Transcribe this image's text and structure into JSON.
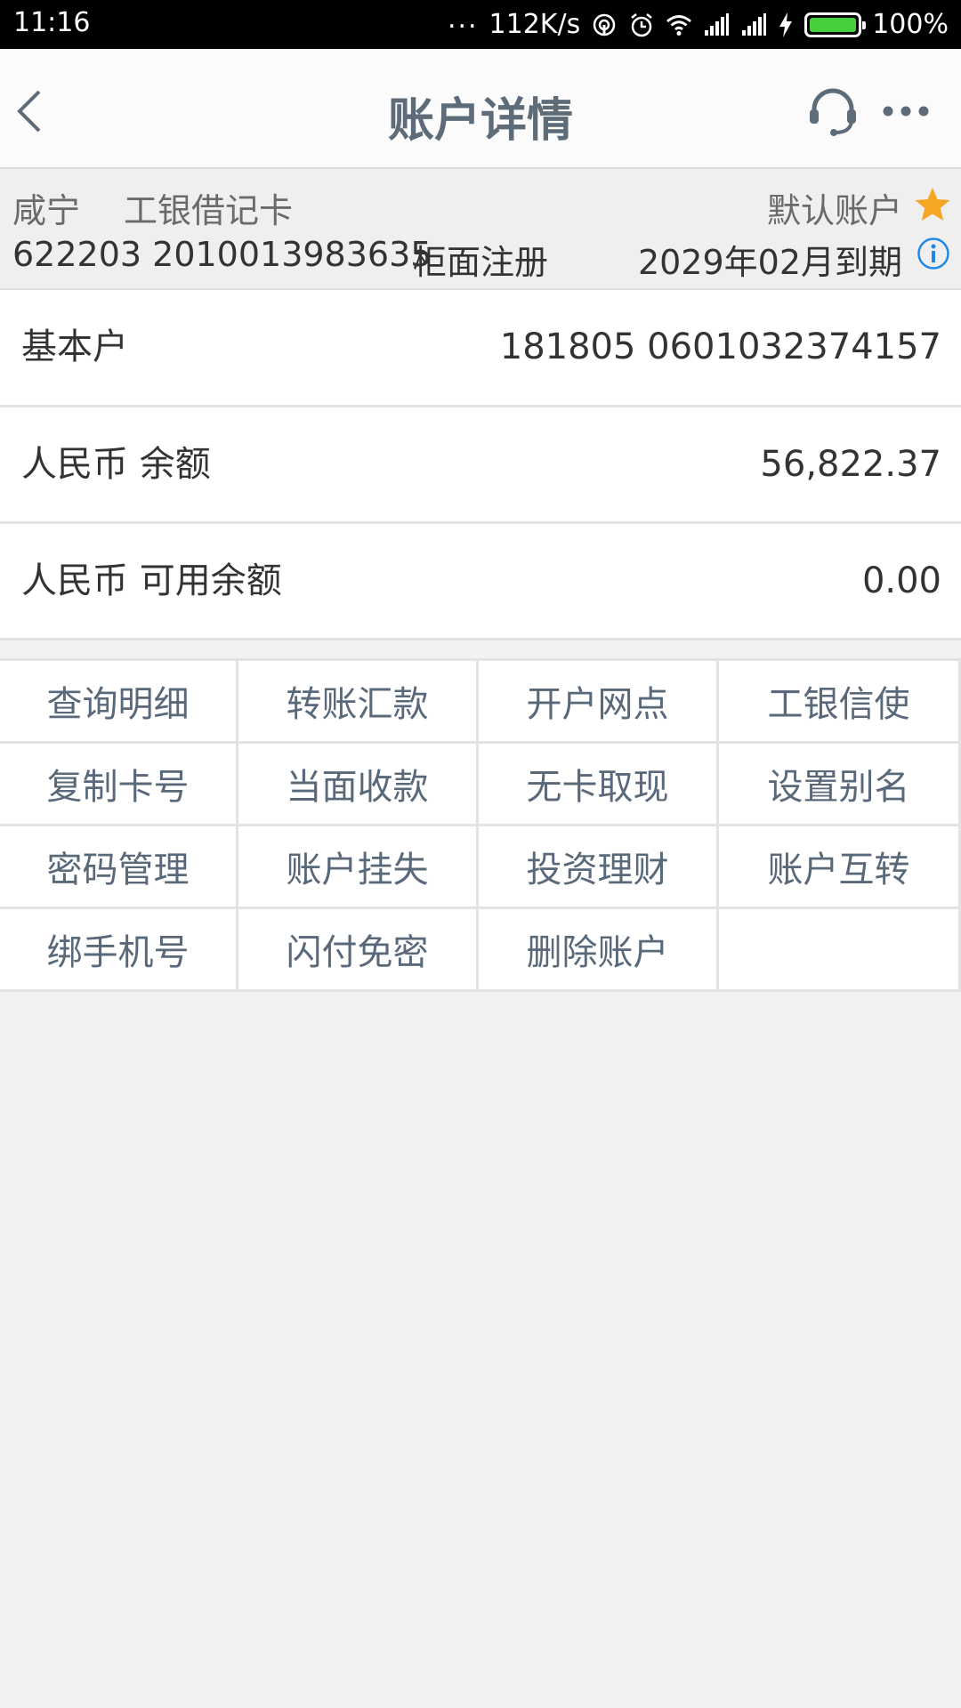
{
  "status_bar": {
    "time": "11:16",
    "dots": "...",
    "net_speed": "112K/s",
    "battery": "100%",
    "battery_level": 1.0
  },
  "header": {
    "title": "账户详情"
  },
  "card": {
    "region": "咸宁",
    "card_type": "工银借记卡",
    "default_label": "默认账户",
    "card_number": "622203 2010013983635",
    "registration": "柜面注册",
    "expiry": "2029年02月到期"
  },
  "details": [
    {
      "label": "基本户",
      "value": "181805 0601032374157"
    },
    {
      "label": "人民币 余额",
      "value": "56,822.37"
    },
    {
      "label": "人民币 可用余额",
      "value": "0.00"
    }
  ],
  "actions": [
    "查询明细",
    "转账汇款",
    "开户网点",
    "工银信使",
    "复制卡号",
    "当面收款",
    "无卡取现",
    "设置别名",
    "密码管理",
    "账户挂失",
    "投资理财",
    "账户互转",
    "绑手机号",
    "闪付免密",
    "删除账户"
  ],
  "colors": {
    "title": "#5e6b78",
    "action_text": "#59697a",
    "star": "#f5a623",
    "info": "#1e88e5"
  },
  "icons": {
    "back": "chevron-left-icon",
    "support": "headset-icon",
    "more": "more-icon",
    "default": "star-icon",
    "info": "info-icon"
  }
}
